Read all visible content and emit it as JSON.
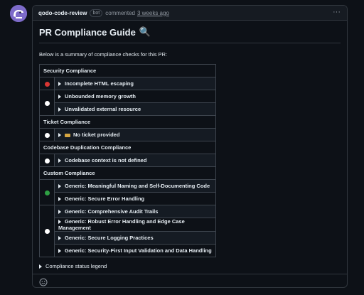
{
  "comment": {
    "author": "qodo-code-review",
    "badge": "bot",
    "action": "commented",
    "time": "3 weeks ago",
    "menu_label": "···"
  },
  "guide": {
    "title": "PR Compliance Guide",
    "title_icon": "🔍",
    "summary": "Below is a summary of compliance checks for this PR:"
  },
  "colors": {
    "red": "#da3633",
    "green": "#2ea043",
    "white": "#ffffff"
  },
  "sections": [
    {
      "title": "Security Compliance",
      "groups": [
        {
          "status": "red",
          "items": [
            "Incomplete HTML escaping"
          ]
        },
        {
          "status": "white",
          "items": [
            "Unbounded memory growth",
            "Unvalidated external resource"
          ]
        }
      ]
    },
    {
      "title": "Ticket Compliance",
      "groups": [
        {
          "status": "white",
          "items": [
            "No ticket provided"
          ]
        }
      ]
    },
    {
      "title": "Codebase Duplication Compliance",
      "groups": [
        {
          "status": "white",
          "items": [
            "Codebase context is not defined"
          ]
        }
      ]
    },
    {
      "title": "Custom Compliance",
      "groups": [
        {
          "status": "green",
          "items": [
            "Generic: Meaningful Naming and Self-Documenting Code",
            "Generic: Secure Error Handling"
          ]
        },
        {
          "status": "white",
          "items": [
            "Generic: Comprehensive Audit Trails",
            "Generic: Robust Error Handling and Edge Case Management",
            "Generic: Secure Logging Practices",
            "Generic: Security-First Input Validation and Data Handling"
          ]
        }
      ]
    }
  ],
  "legend": {
    "label": "Compliance status legend"
  }
}
